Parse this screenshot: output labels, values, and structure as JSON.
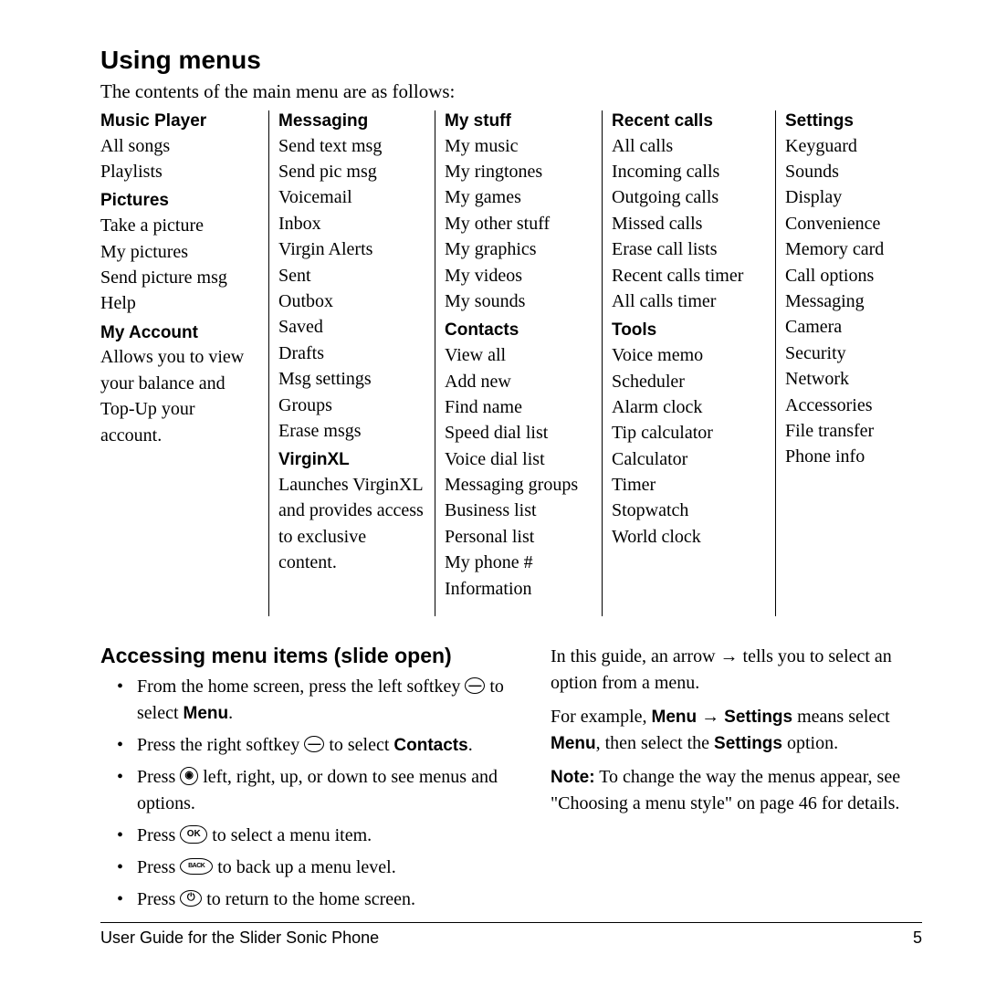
{
  "heading": "Using menus",
  "intro": "The contents of the main menu are as follows:",
  "columns": [
    [
      {
        "type": "cat",
        "text": "Music Player"
      },
      {
        "type": "item",
        "text": "All songs"
      },
      {
        "type": "item",
        "text": "Playlists"
      },
      {
        "type": "cat",
        "text": "Pictures"
      },
      {
        "type": "item",
        "text": "Take a picture"
      },
      {
        "type": "item",
        "text": "My pictures"
      },
      {
        "type": "item",
        "text": "Send picture msg"
      },
      {
        "type": "item",
        "text": "Help"
      },
      {
        "type": "cat",
        "text": "My Account"
      },
      {
        "type": "desc",
        "text": "Allows you to view your balance and Top-Up your account."
      }
    ],
    [
      {
        "type": "cat",
        "text": "Messaging"
      },
      {
        "type": "item",
        "text": "Send text msg"
      },
      {
        "type": "item",
        "text": "Send pic msg"
      },
      {
        "type": "item",
        "text": "Voicemail"
      },
      {
        "type": "item",
        "text": "Inbox"
      },
      {
        "type": "item",
        "text": "Virgin Alerts"
      },
      {
        "type": "item",
        "text": "Sent"
      },
      {
        "type": "item",
        "text": "Outbox"
      },
      {
        "type": "item",
        "text": "Saved"
      },
      {
        "type": "item",
        "text": "Drafts"
      },
      {
        "type": "item",
        "text": "Msg settings"
      },
      {
        "type": "item",
        "text": "Groups"
      },
      {
        "type": "item",
        "text": "Erase msgs"
      },
      {
        "type": "cat",
        "text": "VirginXL"
      },
      {
        "type": "desc",
        "text": "Launches VirginXL and provides access to exclusive content."
      }
    ],
    [
      {
        "type": "cat",
        "text": "My stuff"
      },
      {
        "type": "item",
        "text": "My music"
      },
      {
        "type": "item",
        "text": "My ringtones"
      },
      {
        "type": "item",
        "text": "My games"
      },
      {
        "type": "item",
        "text": "My other stuff"
      },
      {
        "type": "item",
        "text": "My graphics"
      },
      {
        "type": "item",
        "text": "My videos"
      },
      {
        "type": "item",
        "text": "My sounds"
      },
      {
        "type": "cat",
        "text": "Contacts"
      },
      {
        "type": "item",
        "text": "View all"
      },
      {
        "type": "item",
        "text": "Add new"
      },
      {
        "type": "item",
        "text": "Find name"
      },
      {
        "type": "item",
        "text": "Speed dial list"
      },
      {
        "type": "item",
        "text": "Voice dial list"
      },
      {
        "type": "item",
        "text": "Messaging groups"
      },
      {
        "type": "item",
        "text": "Business list"
      },
      {
        "type": "item",
        "text": "Personal list"
      },
      {
        "type": "item",
        "text": "My phone #"
      },
      {
        "type": "item",
        "text": "Information"
      }
    ],
    [
      {
        "type": "cat",
        "text": "Recent calls"
      },
      {
        "type": "item",
        "text": "All calls"
      },
      {
        "type": "item",
        "text": "Incoming calls"
      },
      {
        "type": "item",
        "text": "Outgoing calls"
      },
      {
        "type": "item",
        "text": "Missed calls"
      },
      {
        "type": "item",
        "text": "Erase call lists"
      },
      {
        "type": "item",
        "text": "Recent calls timer"
      },
      {
        "type": "item",
        "text": "All calls timer"
      },
      {
        "type": "cat",
        "text": "Tools"
      },
      {
        "type": "item",
        "text": "Voice memo"
      },
      {
        "type": "item",
        "text": "Scheduler"
      },
      {
        "type": "item",
        "text": "Alarm clock"
      },
      {
        "type": "item",
        "text": "Tip calculator"
      },
      {
        "type": "item",
        "text": "Calculator"
      },
      {
        "type": "item",
        "text": "Timer"
      },
      {
        "type": "item",
        "text": "Stopwatch"
      },
      {
        "type": "item",
        "text": "World clock"
      }
    ],
    [
      {
        "type": "cat",
        "text": "Settings"
      },
      {
        "type": "item",
        "text": "Keyguard"
      },
      {
        "type": "item",
        "text": "Sounds"
      },
      {
        "type": "item",
        "text": "Display"
      },
      {
        "type": "item",
        "text": "Convenience"
      },
      {
        "type": "item",
        "text": "Memory card"
      },
      {
        "type": "item",
        "text": "Call options"
      },
      {
        "type": "item",
        "text": "Messaging"
      },
      {
        "type": "item",
        "text": "Camera"
      },
      {
        "type": "item",
        "text": "Security"
      },
      {
        "type": "item",
        "text": "Network"
      },
      {
        "type": "item",
        "text": "Accessories"
      },
      {
        "type": "item",
        "text": "File transfer"
      },
      {
        "type": "item",
        "text": "Phone info"
      }
    ]
  ],
  "sub_heading": "Accessing menu items (slide open)",
  "bullets": {
    "b1a": "From the home screen, press the left softkey ",
    "b1b": " to select ",
    "b1c": ".",
    "b2a": "Press the right softkey ",
    "b2b": " to select ",
    "b2c": ".",
    "b3a": "Press ",
    "b3b": " left, right, up, or down to see menus and options.",
    "b4a": "Press ",
    "b4b": " to select a menu item.",
    "b5a": "Press ",
    "b5b": " to back up a menu level.",
    "b6a": "Press ",
    "b6b": " to return to the home screen."
  },
  "labels": {
    "menu": "Menu",
    "contacts": "Contacts",
    "settings": "Settings",
    "note": "Note:"
  },
  "icons": {
    "ok": "OK",
    "back": "BACK",
    "end": "⏻",
    "softkey": "—"
  },
  "right": {
    "p1a": "In this guide, an arrow ",
    "p1b": " tells you to select an option from a menu.",
    "p2a": "For example, ",
    "p2b": " means select ",
    "p2c": ", then select the ",
    "p2d": " option.",
    "p3a": " To change the way the menus appear, see \"Choosing a menu style\" on page 46 for details.",
    "arrow": "→"
  },
  "footer": {
    "left": "User Guide for the Slider Sonic Phone",
    "right": "5"
  }
}
